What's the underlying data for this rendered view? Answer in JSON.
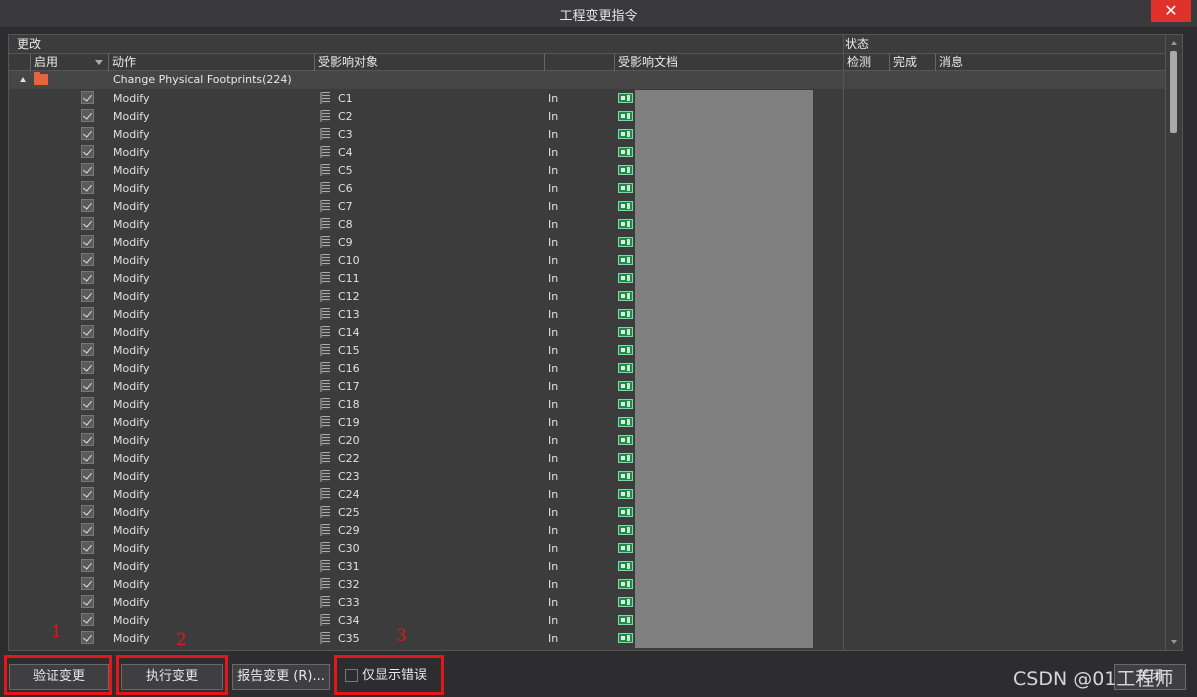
{
  "window": {
    "title": "工程变更指令",
    "close_glyph": "✕"
  },
  "groups": {
    "changes": "更改",
    "status": "状态"
  },
  "columns": {
    "enable": "启用",
    "action": "动作",
    "affected_object": "受影响对象",
    "affected_document": "受影响文档",
    "check": "检测",
    "done": "完成",
    "message": "消息"
  },
  "group_row": {
    "label": "Change Physical Footprints(224)"
  },
  "rows": [
    {
      "action": "Modify",
      "object": "C1",
      "in": "In"
    },
    {
      "action": "Modify",
      "object": "C2",
      "in": "In"
    },
    {
      "action": "Modify",
      "object": "C3",
      "in": "In"
    },
    {
      "action": "Modify",
      "object": "C4",
      "in": "In"
    },
    {
      "action": "Modify",
      "object": "C5",
      "in": "In"
    },
    {
      "action": "Modify",
      "object": "C6",
      "in": "In"
    },
    {
      "action": "Modify",
      "object": "C7",
      "in": "In"
    },
    {
      "action": "Modify",
      "object": "C8",
      "in": "In"
    },
    {
      "action": "Modify",
      "object": "C9",
      "in": "In"
    },
    {
      "action": "Modify",
      "object": "C10",
      "in": "In"
    },
    {
      "action": "Modify",
      "object": "C11",
      "in": "In"
    },
    {
      "action": "Modify",
      "object": "C12",
      "in": "In"
    },
    {
      "action": "Modify",
      "object": "C13",
      "in": "In"
    },
    {
      "action": "Modify",
      "object": "C14",
      "in": "In"
    },
    {
      "action": "Modify",
      "object": "C15",
      "in": "In"
    },
    {
      "action": "Modify",
      "object": "C16",
      "in": "In"
    },
    {
      "action": "Modify",
      "object": "C17",
      "in": "In"
    },
    {
      "action": "Modify",
      "object": "C18",
      "in": "In"
    },
    {
      "action": "Modify",
      "object": "C19",
      "in": "In"
    },
    {
      "action": "Modify",
      "object": "C20",
      "in": "In"
    },
    {
      "action": "Modify",
      "object": "C22",
      "in": "In"
    },
    {
      "action": "Modify",
      "object": "C23",
      "in": "In"
    },
    {
      "action": "Modify",
      "object": "C24",
      "in": "In"
    },
    {
      "action": "Modify",
      "object": "C25",
      "in": "In"
    },
    {
      "action": "Modify",
      "object": "C29",
      "in": "In"
    },
    {
      "action": "Modify",
      "object": "C30",
      "in": "In"
    },
    {
      "action": "Modify",
      "object": "C31",
      "in": "In"
    },
    {
      "action": "Modify",
      "object": "C32",
      "in": "In"
    },
    {
      "action": "Modify",
      "object": "C33",
      "in": "In"
    },
    {
      "action": "Modify",
      "object": "C34",
      "in": "In"
    },
    {
      "action": "Modify",
      "object": "C35",
      "in": "In"
    }
  ],
  "buttons": {
    "validate": "验证变更",
    "execute": "执行变更",
    "report": "报告变更 (R)...",
    "only_errors": "仅显示错误",
    "close": "关闭"
  },
  "annotations": [
    "1",
    "2",
    "3"
  ],
  "watermark": "CSDN @01工程师",
  "colors": {
    "highlight": "#e5161a",
    "background": "#2d2d30",
    "doc_block": "#808080"
  }
}
